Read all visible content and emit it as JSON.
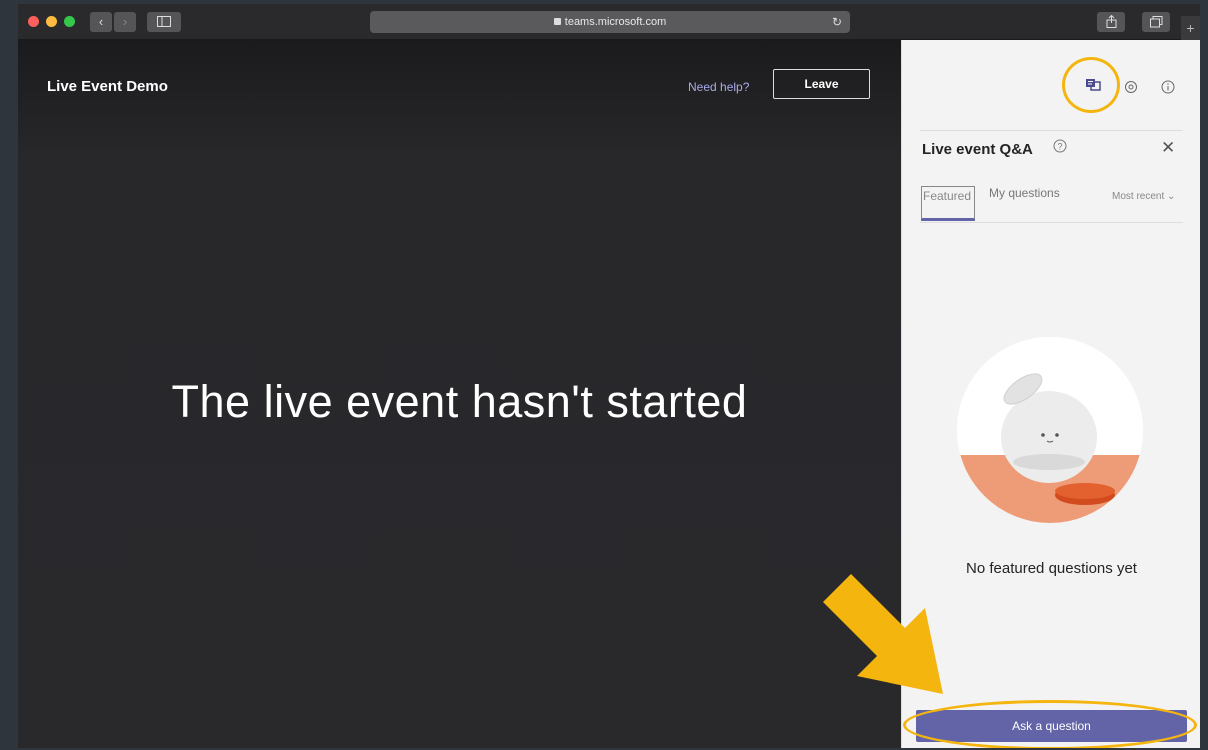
{
  "browser": {
    "url": "teams.microsoft.com",
    "nav_back": "‹",
    "nav_forward": "›",
    "reload_glyph": "↻",
    "plus_glyph": "+"
  },
  "stage": {
    "event_title": "Live Event Demo",
    "help_link": "Need help?",
    "leave_label": "Leave",
    "status_message": "The live event hasn't started"
  },
  "panel": {
    "qa_title": "Live event Q&A",
    "close_glyph": "✕",
    "tabs": [
      {
        "label": "Featured",
        "selected": true
      },
      {
        "label": "My questions",
        "selected": false
      }
    ],
    "sort_label": "Most recent ⌄",
    "empty_message": "No featured questions yet",
    "ask_label": "Ask a question"
  },
  "colors": {
    "accent": "#6264a7",
    "highlight": "#f5b50f",
    "stage_bg": "#29292c",
    "panel_bg": "#f3f3f3"
  }
}
